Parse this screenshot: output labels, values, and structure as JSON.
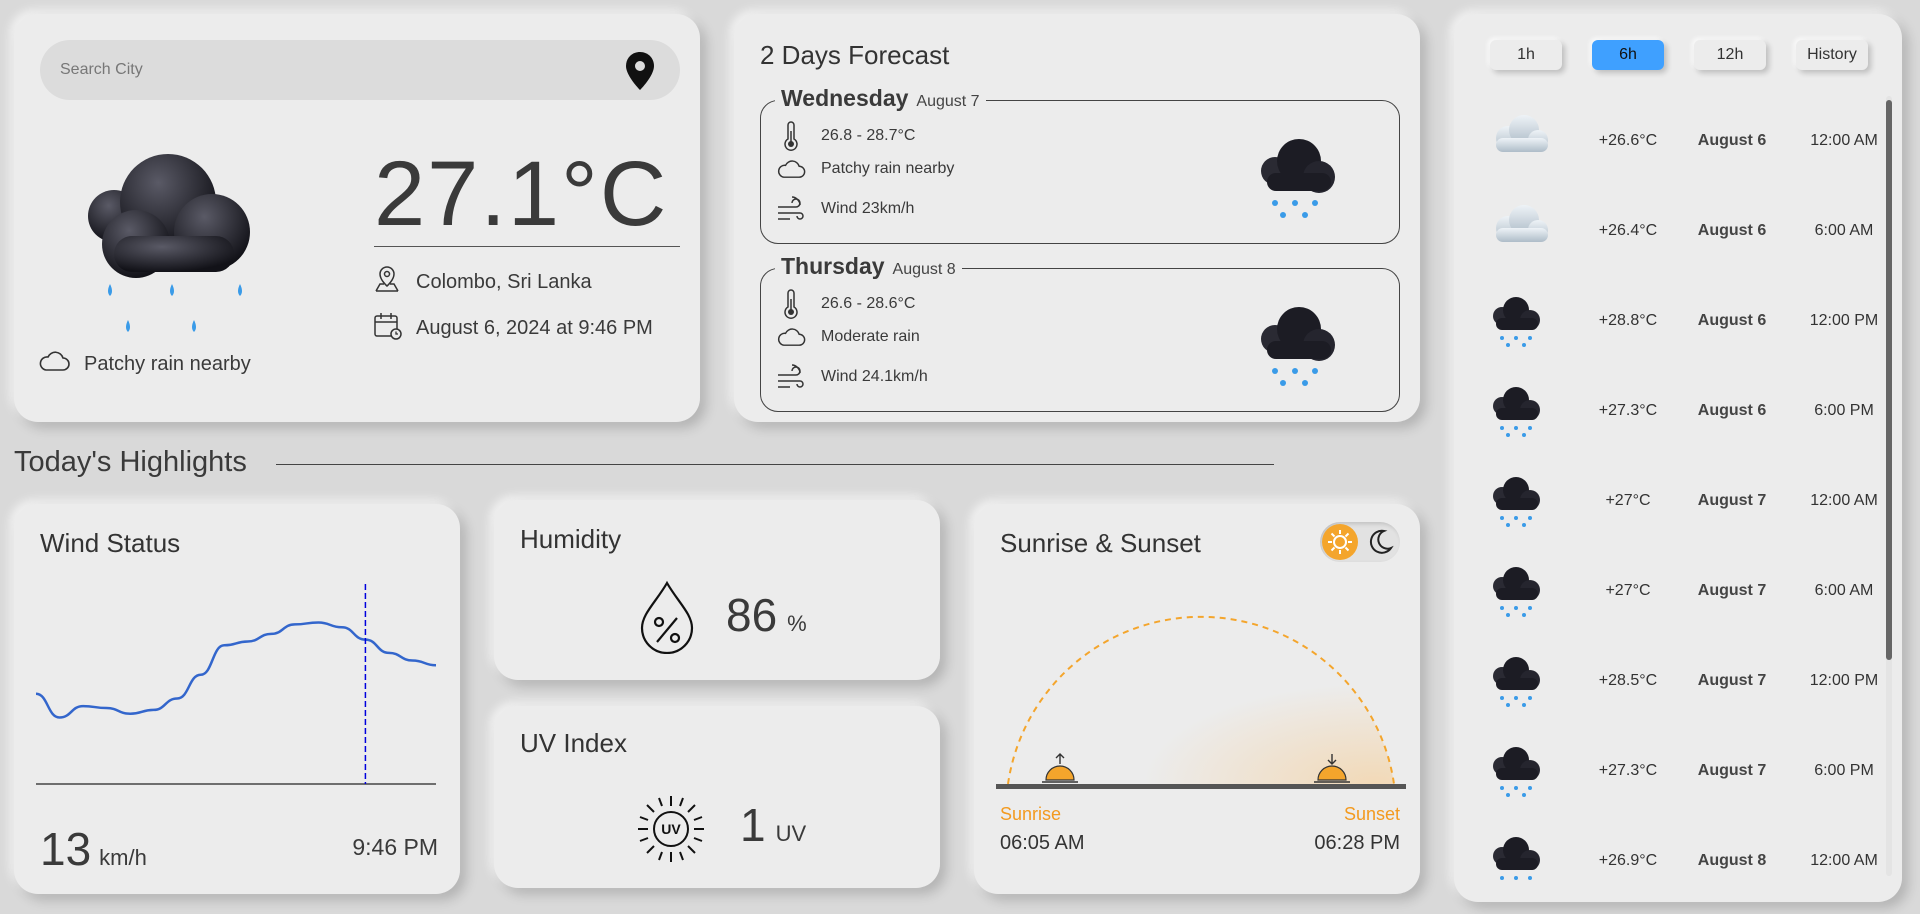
{
  "current": {
    "search_placeholder": "Search City",
    "temperature": "27.1°C",
    "location": "Colombo, Sri Lanka",
    "datetime": "August 6, 2024 at 9:46 PM",
    "condition": "Patchy rain nearby"
  },
  "forecast": {
    "title": "2 Days Forecast",
    "days": [
      {
        "name": "Wednesday",
        "date": "August 7",
        "range": "26.8 - 28.7°C",
        "condition": "Patchy rain nearby",
        "wind": "Wind 23km/h"
      },
      {
        "name": "Thursday",
        "date": "August 8",
        "range": "26.6 - 28.6°C",
        "condition": "Moderate rain",
        "wind": "Wind 24.1km/h"
      }
    ]
  },
  "highlights": {
    "title": "Today's Highlights",
    "wind": {
      "title": "Wind Status",
      "value": "13",
      "unit": "km/h",
      "time": "9:46 PM"
    },
    "humidity": {
      "title": "Humidity",
      "value": "86",
      "unit": "%"
    },
    "uv": {
      "title": "UV Index",
      "value": "1",
      "unit": "UV"
    },
    "sun": {
      "title": "Sunrise & Sunset",
      "sunrise_label": "Sunrise",
      "sunset_label": "Sunset",
      "sunrise": "06:05 AM",
      "sunset": "06:28 PM"
    }
  },
  "hourly": {
    "tabs": [
      "1h",
      "6h",
      "12h",
      "History"
    ],
    "active_tab": "6h",
    "rows": [
      {
        "icon": "cloud-icon",
        "temp": "+26.6°C",
        "date": "August 6",
        "time": "12:00 AM"
      },
      {
        "icon": "cloud-icon",
        "temp": "+26.4°C",
        "date": "August 6",
        "time": "6:00 AM"
      },
      {
        "icon": "rain-cloud-icon",
        "temp": "+28.8°C",
        "date": "August 6",
        "time": "12:00 PM"
      },
      {
        "icon": "rain-cloud-icon",
        "temp": "+27.3°C",
        "date": "August 6",
        "time": "6:00 PM"
      },
      {
        "icon": "rain-cloud-icon",
        "temp": "+27°C",
        "date": "August 7",
        "time": "12:00 AM"
      },
      {
        "icon": "rain-cloud-icon",
        "temp": "+27°C",
        "date": "August 7",
        "time": "6:00 AM"
      },
      {
        "icon": "rain-cloud-icon",
        "temp": "+28.5°C",
        "date": "August 7",
        "time": "12:00 PM"
      },
      {
        "icon": "rain-cloud-icon",
        "temp": "+27.3°C",
        "date": "August 7",
        "time": "6:00 PM"
      },
      {
        "icon": "rain-cloud-icon",
        "temp": "+26.9°C",
        "date": "August 8",
        "time": "12:00 AM"
      }
    ]
  },
  "chart_data": {
    "type": "line",
    "series": [
      {
        "values": [
          9.5,
          7.0,
          8.2,
          8.0,
          7.4,
          7.8,
          9.0,
          11.5,
          14.6,
          15.0,
          15.8,
          16.8,
          17.0,
          16.5,
          15.2,
          13.8,
          13.0,
          12.5
        ]
      }
    ],
    "marker_index": 14,
    "colors": {
      "line": "#3366cc",
      "marker": "#0000dd"
    }
  },
  "colors": {
    "accent": "#3fa0ff",
    "sun": "#f4a52c",
    "sunset_label": "#f39a1f"
  }
}
